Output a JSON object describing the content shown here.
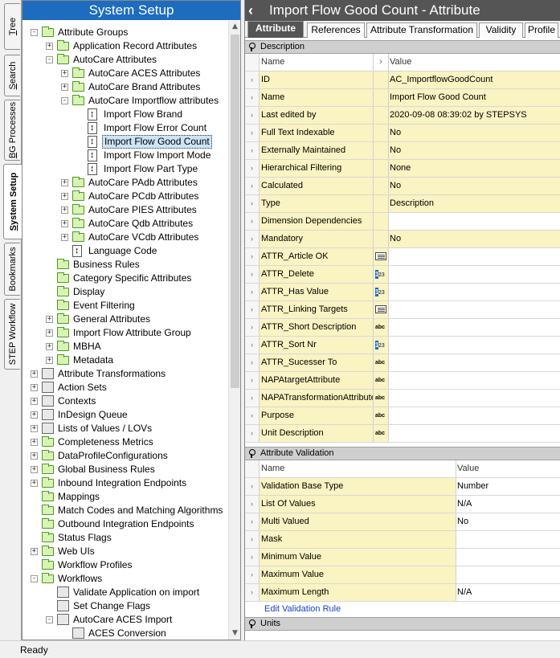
{
  "vertical_tabs": [
    {
      "label": "Tree",
      "ul": "T",
      "rest": "ree",
      "active": false
    },
    {
      "label": "Search",
      "ul": "S",
      "rest": "earch",
      "active": false
    },
    {
      "label": "BG Processes",
      "ul": "B",
      "rest": "G Processes",
      "active": false
    },
    {
      "label": "System Setup",
      "ul": "S",
      "rest": "ystem Setup",
      "active": true
    },
    {
      "label": "Bookmarks",
      "ul": "",
      "rest": "Bookmarks",
      "active": false
    },
    {
      "label": "STEP Workflow",
      "ul": "",
      "rest": "STEP Workflow",
      "active": false
    }
  ],
  "left_title": "System Setup",
  "tree": [
    {
      "label": "Attribute Groups",
      "depth": 0,
      "exp": "-",
      "icon": "folder"
    },
    {
      "label": "Application Record Attributes",
      "depth": 1,
      "exp": "+",
      "icon": "folder"
    },
    {
      "label": "AutoCare Attributes",
      "depth": 1,
      "exp": "-",
      "icon": "folder"
    },
    {
      "label": "AutoCare ACES Attributes",
      "depth": 2,
      "exp": "+",
      "icon": "folder"
    },
    {
      "label": "AutoCare Brand Attributes",
      "depth": 2,
      "exp": "+",
      "icon": "folder"
    },
    {
      "label": "AutoCare Importflow attributes",
      "depth": 2,
      "exp": "-",
      "icon": "folder"
    },
    {
      "label": "Import Flow Brand",
      "depth": 3,
      "exp": "",
      "icon": "attr"
    },
    {
      "label": "Import Flow Error Count",
      "depth": 3,
      "exp": "",
      "icon": "attr"
    },
    {
      "label": "Import Flow Good Count",
      "depth": 3,
      "exp": "",
      "icon": "attr",
      "selected": true
    },
    {
      "label": "Import Flow Import Mode",
      "depth": 3,
      "exp": "",
      "icon": "attr"
    },
    {
      "label": "Import Flow Part Type",
      "depth": 3,
      "exp": "",
      "icon": "attr"
    },
    {
      "label": "AutoCare PAdb Attributes",
      "depth": 2,
      "exp": "+",
      "icon": "folder"
    },
    {
      "label": "AutoCare PCdb Attributes",
      "depth": 2,
      "exp": "+",
      "icon": "folder"
    },
    {
      "label": "AutoCare PIES Attributes",
      "depth": 2,
      "exp": "+",
      "icon": "folder"
    },
    {
      "label": "AutoCare Qdb Attributes",
      "depth": 2,
      "exp": "+",
      "icon": "folder"
    },
    {
      "label": "AutoCare VCdb Attributes",
      "depth": 2,
      "exp": "+",
      "icon": "folder"
    },
    {
      "label": "Language Code",
      "depth": 2,
      "exp": "",
      "icon": "attr"
    },
    {
      "label": "Business Rules",
      "depth": 1,
      "exp": "",
      "icon": "folder"
    },
    {
      "label": "Category Specific Attributes",
      "depth": 1,
      "exp": "",
      "icon": "folder"
    },
    {
      "label": "Display",
      "depth": 1,
      "exp": "",
      "icon": "folder"
    },
    {
      "label": "Event Filtering",
      "depth": 1,
      "exp": "",
      "icon": "folder"
    },
    {
      "label": "General Attributes",
      "depth": 1,
      "exp": "+",
      "icon": "folder"
    },
    {
      "label": "Import Flow Attribute Group",
      "depth": 1,
      "exp": "+",
      "icon": "folder"
    },
    {
      "label": "MBHA",
      "depth": 1,
      "exp": "+",
      "icon": "folder"
    },
    {
      "label": "Metadata",
      "depth": 1,
      "exp": "+",
      "icon": "folder"
    },
    {
      "label": "Attribute Transformations",
      "depth": 0,
      "exp": "+",
      "icon": "special"
    },
    {
      "label": "Action Sets",
      "depth": 0,
      "exp": "+",
      "icon": "special"
    },
    {
      "label": "Contexts",
      "depth": 0,
      "exp": "+",
      "icon": "special"
    },
    {
      "label": "InDesign Queue",
      "depth": 0,
      "exp": "+",
      "icon": "special"
    },
    {
      "label": "Lists of Values / LOVs",
      "depth": 0,
      "exp": "+",
      "icon": "special"
    },
    {
      "label": "Completeness Metrics",
      "depth": 0,
      "exp": "+",
      "icon": "folder"
    },
    {
      "label": "DataProfileConfigurations",
      "depth": 0,
      "exp": "+",
      "icon": "folder"
    },
    {
      "label": "Global Business Rules",
      "depth": 0,
      "exp": "+",
      "icon": "folder"
    },
    {
      "label": "Inbound Integration Endpoints",
      "depth": 0,
      "exp": "+",
      "icon": "folder"
    },
    {
      "label": "Mappings",
      "depth": 0,
      "exp": "",
      "icon": "folder"
    },
    {
      "label": "Match Codes and Matching Algorithms",
      "depth": 0,
      "exp": "",
      "icon": "folder"
    },
    {
      "label": "Outbound Integration Endpoints",
      "depth": 0,
      "exp": "",
      "icon": "folder"
    },
    {
      "label": "Status Flags",
      "depth": 0,
      "exp": "",
      "icon": "folder"
    },
    {
      "label": "Web UIs",
      "depth": 0,
      "exp": "+",
      "icon": "folder"
    },
    {
      "label": "Workflow Profiles",
      "depth": 0,
      "exp": "",
      "icon": "folder"
    },
    {
      "label": "Workflows",
      "depth": 0,
      "exp": "-",
      "icon": "folder"
    },
    {
      "label": "Validate Application on import",
      "depth": 1,
      "exp": "",
      "icon": "special"
    },
    {
      "label": "Set Change Flags",
      "depth": 1,
      "exp": "",
      "icon": "special"
    },
    {
      "label": "AutoCare ACES Import",
      "depth": 1,
      "exp": "-",
      "icon": "special"
    },
    {
      "label": "ACES Conversion",
      "depth": 2,
      "exp": "",
      "icon": "special"
    }
  ],
  "status": "Ready",
  "right_title": "Import Flow Good Count - Attribute",
  "tabs": [
    "Attribute",
    "References",
    "Attribute Transformation",
    "Validity",
    "Profile"
  ],
  "sections": {
    "description": "Description",
    "validation": "Attribute Validation",
    "units": "Units"
  },
  "desc_header": {
    "name": "Name",
    "value": "Value"
  },
  "desc_rows": [
    {
      "name": "ID",
      "value": "AC_ImportflowGoodCount",
      "type": ""
    },
    {
      "name": "Name",
      "value": "Import Flow Good Count",
      "type": ""
    },
    {
      "name": "Last edited by",
      "value": "2020-09-08 08:39:02 by STEPSYS",
      "type": ""
    },
    {
      "name": "Full Text Indexable",
      "value": "No",
      "type": ""
    },
    {
      "name": "Externally Maintained",
      "value": "No",
      "type": ""
    },
    {
      "name": "Hierarchical Filtering",
      "value": "None",
      "type": ""
    },
    {
      "name": "Calculated",
      "value": "No",
      "type": ""
    },
    {
      "name": "Type",
      "value": "Description",
      "type": ""
    },
    {
      "name": "Dimension Dependencies",
      "value": "",
      "type": ""
    },
    {
      "name": "Mandatory",
      "value": "No",
      "type": ""
    },
    {
      "name": "ATTR_Article OK",
      "value": "",
      "type": "txt"
    },
    {
      "name": "ATTR_Delete",
      "value": "",
      "type": "num"
    },
    {
      "name": "ATTR_Has Value",
      "value": "",
      "type": "num"
    },
    {
      "name": "ATTR_Linking Targets",
      "value": "",
      "type": "txt"
    },
    {
      "name": "ATTR_Short Description",
      "value": "",
      "type": "abc"
    },
    {
      "name": "ATTR_Sort Nr",
      "value": "",
      "type": "num"
    },
    {
      "name": "ATTR_Sucesser To",
      "value": "",
      "type": "abc"
    },
    {
      "name": "NAPAtargetAttribute",
      "value": "",
      "type": "abc"
    },
    {
      "name": "NAPATransformationAttribute",
      "value": "",
      "type": "abc"
    },
    {
      "name": "Purpose",
      "value": "",
      "type": "abc"
    },
    {
      "name": "Unit Description",
      "value": "",
      "type": "abc"
    }
  ],
  "val_header": {
    "name": "Name",
    "value": "Value"
  },
  "val_rows": [
    {
      "name": "Validation Base Type",
      "value": "Number"
    },
    {
      "name": "List Of Values",
      "value": "N/A"
    },
    {
      "name": "Multi Valued",
      "value": "No"
    },
    {
      "name": "Mask",
      "value": ""
    },
    {
      "name": "Minimum Value",
      "value": ""
    },
    {
      "name": "Maximum Value",
      "value": ""
    },
    {
      "name": "Maximum Length",
      "value": "N/A"
    }
  ],
  "edit_validation_link": "Edit Validation Rule"
}
